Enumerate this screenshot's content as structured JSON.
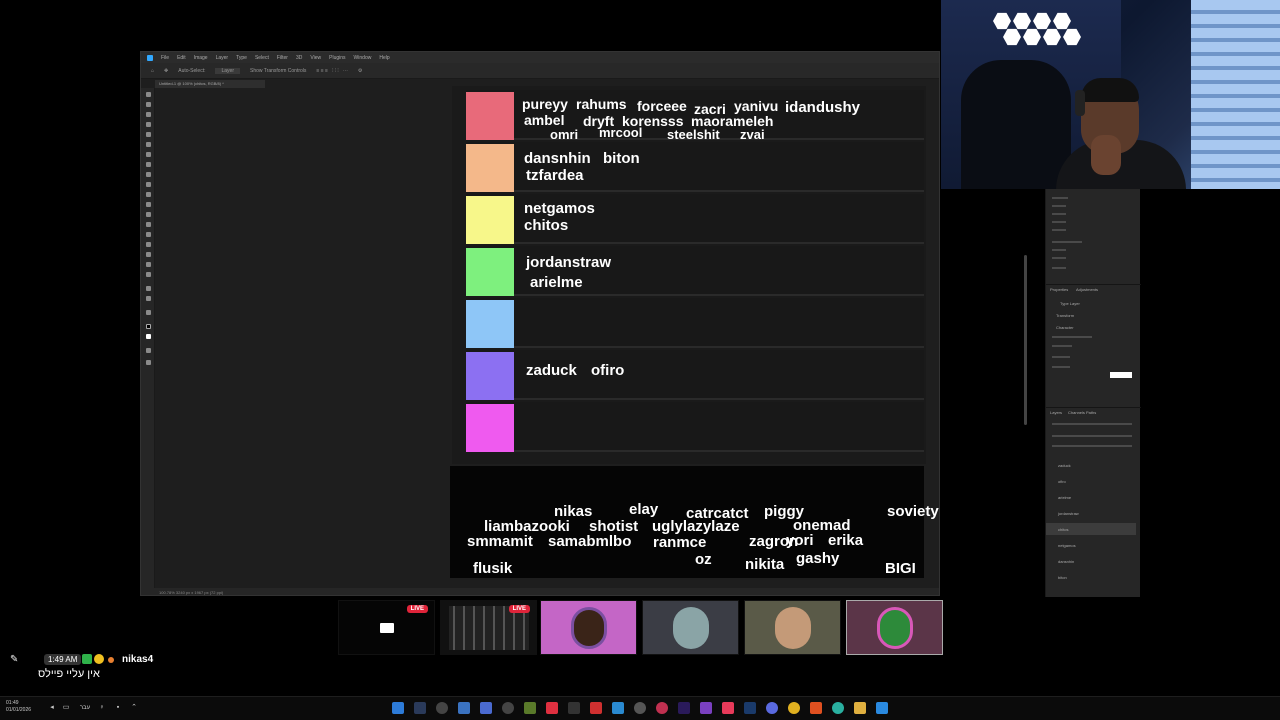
{
  "photoshop": {
    "menu_items": [
      "File",
      "Edit",
      "Image",
      "Layer",
      "Type",
      "Select",
      "Filter",
      "3D",
      "View",
      "Plugins",
      "Window",
      "Help"
    ],
    "doc_tab": "Untitled-1 @ 100% (chitos, RGB/8) *",
    "options": [
      "Auto-Select:",
      "Layer",
      "Show Transform Controls"
    ],
    "status": "100.78%   3240 px x 1967 px (72 ppi)"
  },
  "tiers": [
    {
      "color": "#e86a7a",
      "names": [
        "pureyy",
        "rahums",
        "forceee",
        "zacri",
        "yanivu",
        "idandushy",
        "ambel",
        "dryft",
        "korensss",
        "maorameleh",
        "omri",
        "mrcool",
        "steelshit",
        "zvai"
      ]
    },
    {
      "color": "#f4b88a",
      "names": [
        "dansnhin",
        "biton",
        "tzfardea"
      ]
    },
    {
      "color": "#f7f78a",
      "names": [
        "netgamos",
        "chitos"
      ]
    },
    {
      "color": "#7ef07e",
      "names": [
        "jordanstraw",
        "arielme"
      ]
    },
    {
      "color": "#8ec6f7",
      "names": []
    },
    {
      "color": "#8c70f2",
      "names": [
        "zaduck",
        "ofiro"
      ]
    },
    {
      "color": "#ef5aef",
      "names": []
    }
  ],
  "pool": [
    "nikas",
    "elay",
    "catrcatct",
    "piggy",
    "soviety",
    "liambazooki",
    "shotist",
    "uglylazylaze",
    "onemad",
    "smmamit",
    "samabmlbo",
    "ranmce",
    "zagron",
    "yori",
    "erika",
    "oz",
    "nikita",
    "gashy",
    "flusik",
    "BIGI"
  ],
  "right_panel": {
    "properties_tab": "Properties",
    "adjustments_tab": "Adjustments",
    "type_layer": "Type Layer",
    "transform": "Transform",
    "character": "Character",
    "layers_tab": "Layers",
    "channels_tab": "Channels",
    "paths_tab": "Paths",
    "layer_names": [
      "zaduck",
      "ofiro",
      "arielme",
      "jordanstraw",
      "chitos",
      "netgamos",
      "dansnhin",
      "biton"
    ]
  },
  "streams": [
    {
      "live": "LIVE"
    },
    {
      "live": "LIVE"
    },
    {},
    {},
    {},
    {}
  ],
  "chat": {
    "time": "1:49 AM",
    "user": "nikas4",
    "message": "אין עליי פיילס"
  },
  "taskbar": {
    "time": "01:49",
    "date": "01/01/2026",
    "lang": "עבר"
  },
  "colors": {
    "live": "#e0243a",
    "ps_bg": "#1e1e1e",
    "tier_row": "#181818"
  }
}
